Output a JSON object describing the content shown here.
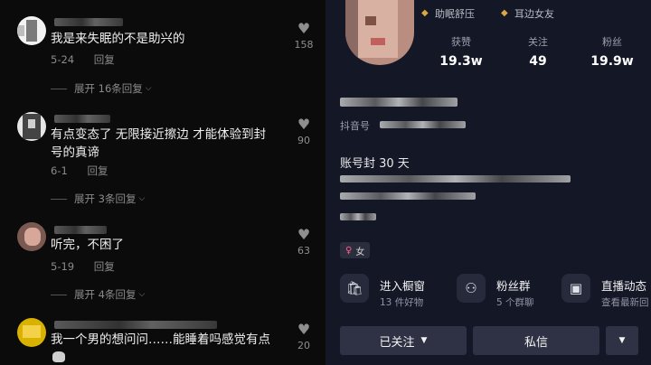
{
  "comments": [
    {
      "text": "我是来失眠的不是助兴的",
      "date": "5-24",
      "reply": "回复",
      "expand": "展开 16条回复",
      "likes": "158"
    },
    {
      "text_line1": "有点变态了 无限接近擦边 才能体验到封",
      "text_line2": "号的真谛",
      "date": "6-1",
      "reply": "回复",
      "expand": "展开 3条回复",
      "likes": "90"
    },
    {
      "text": "听完，不困了",
      "date": "5-19",
      "reply": "回复",
      "expand": "展开 4条回复",
      "likes": "63"
    },
    {
      "text": "我一个男的想问问……能睡着吗感觉有点",
      "likes": "20"
    }
  ],
  "profile": {
    "tags": [
      "助眠舒压",
      "耳边女友"
    ],
    "stats": [
      {
        "label": "获赞",
        "value": "19.3w"
      },
      {
        "label": "关注",
        "value": "49"
      },
      {
        "label": "粉丝",
        "value": "19.9w"
      }
    ],
    "douyin_label": "抖音号",
    "bio_line1": "账号封 30 天",
    "gender": "女",
    "features": [
      {
        "title": "进入橱窗",
        "sub": "13 件好物"
      },
      {
        "title": "粉丝群",
        "sub": "5 个群聊"
      },
      {
        "title": "直播动态",
        "sub": "查看最新回"
      }
    ],
    "followed_label": "已关注",
    "message_label": "私信"
  }
}
